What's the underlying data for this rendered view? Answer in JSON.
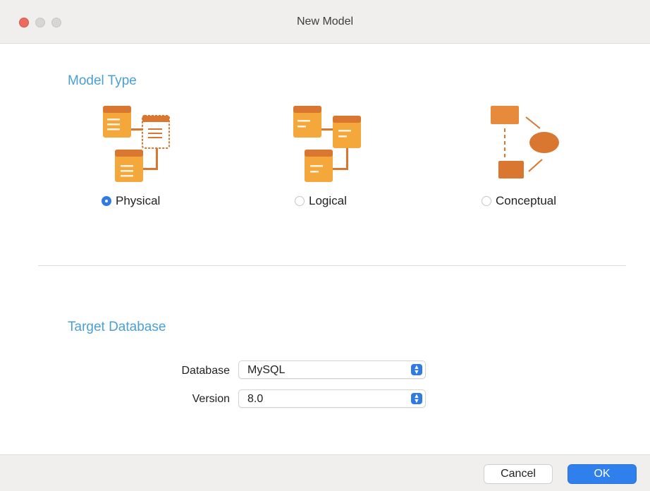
{
  "window": {
    "title": "New Model",
    "controls": [
      "close",
      "minimize",
      "zoom"
    ]
  },
  "model_type": {
    "heading": "Model Type",
    "options": [
      {
        "label": "Physical",
        "icon": "physical-model-icon",
        "selected": true
      },
      {
        "label": "Logical",
        "icon": "logical-model-icon",
        "selected": false
      },
      {
        "label": "Conceptual",
        "icon": "conceptual-model-icon",
        "selected": false
      }
    ]
  },
  "target_database": {
    "heading": "Target Database",
    "database_label": "Database",
    "database_value": "MySQL",
    "version_label": "Version",
    "version_value": "8.0"
  },
  "footer": {
    "cancel_label": "Cancel",
    "ok_label": "OK"
  },
  "colors": {
    "accent": "#2f80ed",
    "heading": "#4aa0d4",
    "icon_orange": "#f4a83c",
    "icon_dark_orange": "#d9762f",
    "close_button": "#ec6a5e"
  }
}
